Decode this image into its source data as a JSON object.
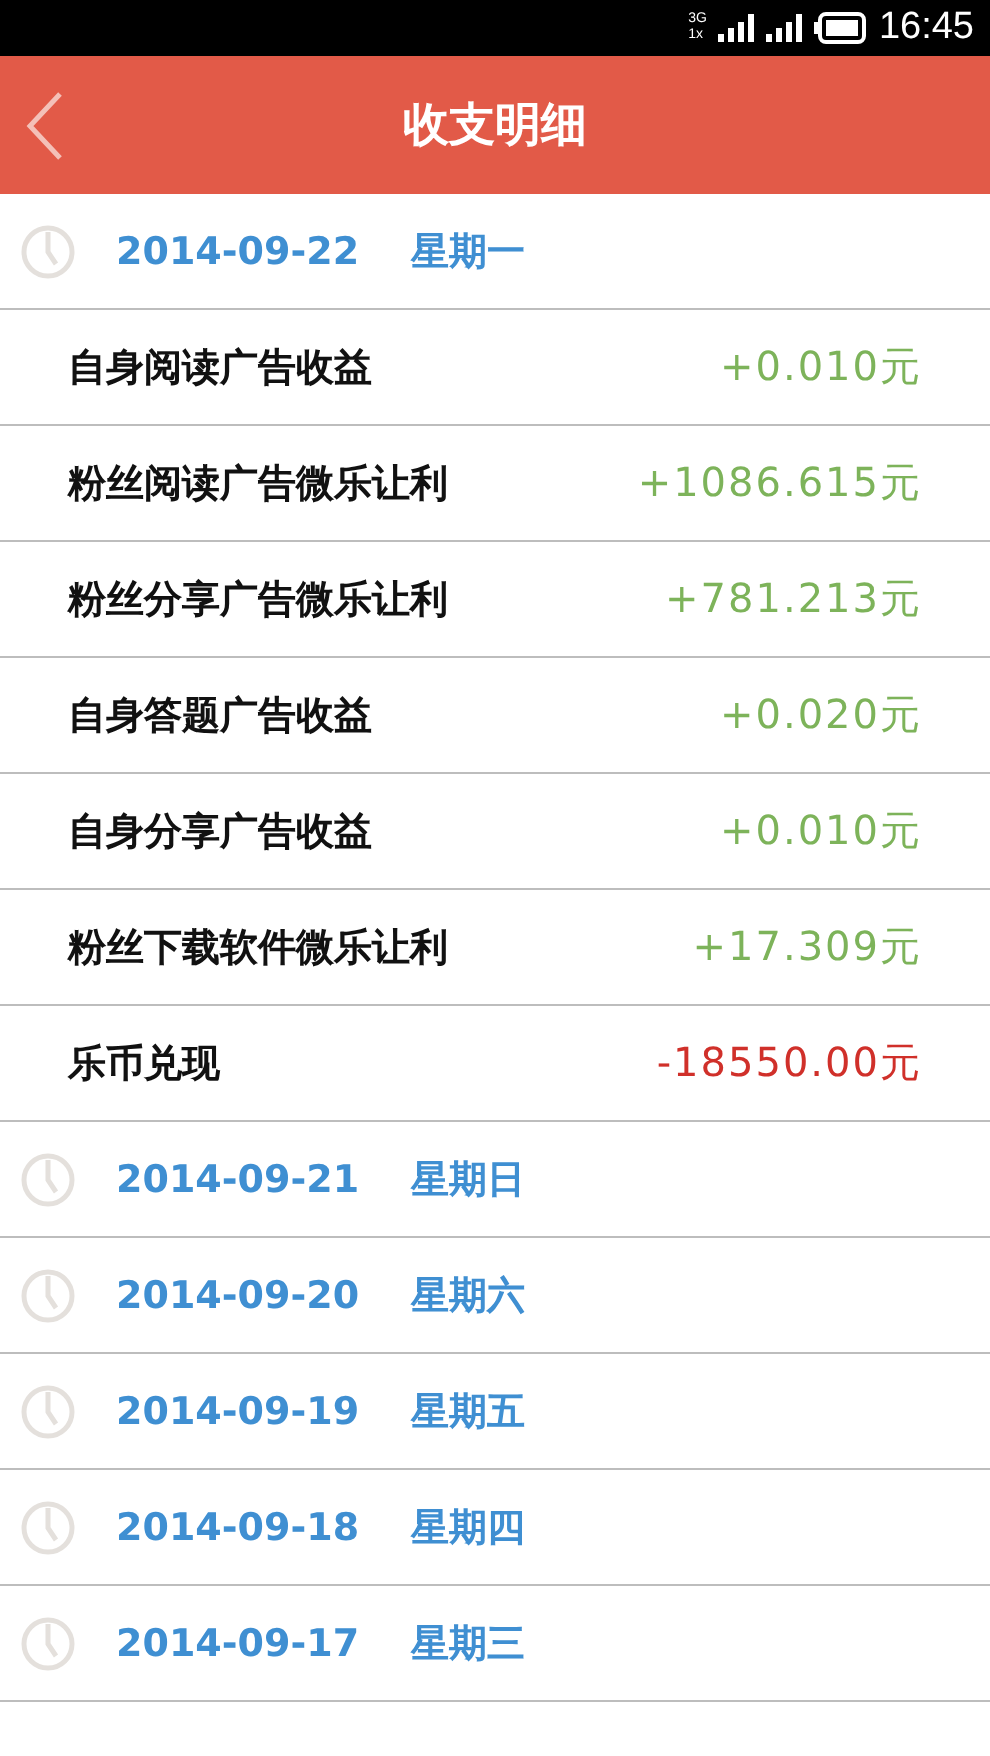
{
  "status_bar": {
    "network_top": "3G",
    "network_bottom": "1x",
    "time": "16:45"
  },
  "header": {
    "title": "收支明细"
  },
  "days": [
    {
      "date": "2014-09-22",
      "weekday": "星期一",
      "entries": [
        {
          "label": "自身阅读广告收益",
          "amount": "+0.010元",
          "kind": "income"
        },
        {
          "label": "粉丝阅读广告微乐让利",
          "amount": "+1086.615元",
          "kind": "income"
        },
        {
          "label": "粉丝分享广告微乐让利",
          "amount": "+781.213元",
          "kind": "income"
        },
        {
          "label": "自身答题广告收益",
          "amount": "+0.020元",
          "kind": "income"
        },
        {
          "label": "自身分享广告收益",
          "amount": "+0.010元",
          "kind": "income"
        },
        {
          "label": "粉丝下载软件微乐让利",
          "amount": "+17.309元",
          "kind": "income"
        },
        {
          "label": "乐币兑现",
          "amount": "-18550.00元",
          "kind": "expense"
        }
      ]
    },
    {
      "date": "2014-09-21",
      "weekday": "星期日"
    },
    {
      "date": "2014-09-20",
      "weekday": "星期六"
    },
    {
      "date": "2014-09-19",
      "weekday": "星期五"
    },
    {
      "date": "2014-09-18",
      "weekday": "星期四"
    },
    {
      "date": "2014-09-17",
      "weekday": "星期三"
    }
  ]
}
